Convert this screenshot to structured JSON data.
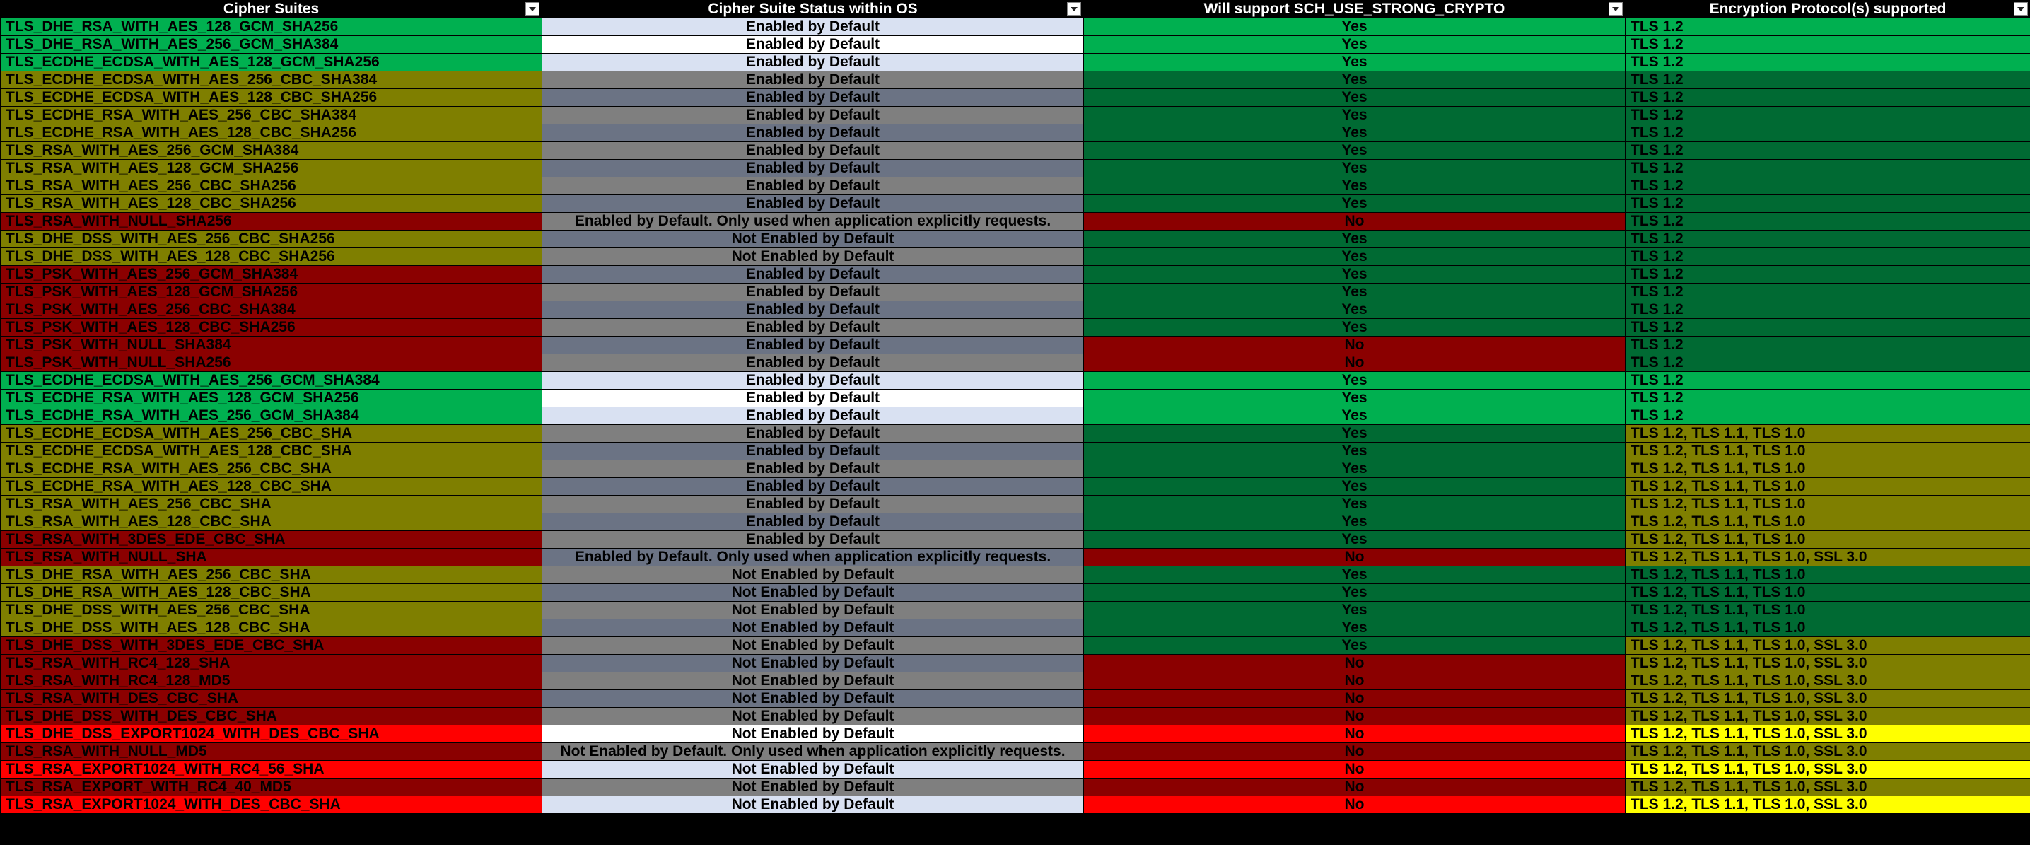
{
  "headers": [
    "Cipher Suites",
    "Cipher Suite Status within OS",
    "Will support SCH_USE_STRONG_CRYPTO",
    "Encryption Protocol(s) supported"
  ],
  "colors": {
    "bright_green": "#00b050",
    "dark_green": "#006a33",
    "olive": "#7f7f00",
    "dark_red": "#8b0000",
    "red": "#ff0000",
    "yellow": "#ffff00",
    "light_blue": "#d9e1f2",
    "white": "#ffffff",
    "gray": "#7f7f7f",
    "slate": "#6b7384"
  },
  "rows": [
    {
      "suite": "TLS_DHE_RSA_WITH_AES_128_GCM_SHA256",
      "status": "Enabled by Default",
      "strong": "Yes",
      "protocols": "TLS 1.2",
      "c1": "bright_green",
      "c2": "light_blue",
      "c3": "bright_green",
      "c4": "bright_green"
    },
    {
      "suite": "TLS_DHE_RSA_WITH_AES_256_GCM_SHA384",
      "status": "Enabled by Default",
      "strong": "Yes",
      "protocols": "TLS 1.2",
      "c1": "bright_green",
      "c2": "white",
      "c3": "bright_green",
      "c4": "bright_green"
    },
    {
      "suite": "TLS_ECDHE_ECDSA_WITH_AES_128_GCM_SHA256",
      "status": "Enabled by Default",
      "strong": "Yes",
      "protocols": "TLS 1.2",
      "c1": "bright_green",
      "c2": "light_blue",
      "c3": "bright_green",
      "c4": "bright_green"
    },
    {
      "suite": "TLS_ECDHE_ECDSA_WITH_AES_256_CBC_SHA384",
      "status": "Enabled by Default",
      "strong": "Yes",
      "protocols": "TLS 1.2",
      "c1": "olive",
      "c2": "gray",
      "c3": "dark_green",
      "c4": "dark_green"
    },
    {
      "suite": "TLS_ECDHE_ECDSA_WITH_AES_128_CBC_SHA256",
      "status": "Enabled by Default",
      "strong": "Yes",
      "protocols": "TLS 1.2",
      "c1": "olive",
      "c2": "slate",
      "c3": "dark_green",
      "c4": "dark_green"
    },
    {
      "suite": "TLS_ECDHE_RSA_WITH_AES_256_CBC_SHA384",
      "status": "Enabled by Default",
      "strong": "Yes",
      "protocols": "TLS 1.2",
      "c1": "olive",
      "c2": "gray",
      "c3": "dark_green",
      "c4": "dark_green"
    },
    {
      "suite": "TLS_ECDHE_RSA_WITH_AES_128_CBC_SHA256",
      "status": "Enabled by Default",
      "strong": "Yes",
      "protocols": "TLS 1.2",
      "c1": "olive",
      "c2": "slate",
      "c3": "dark_green",
      "c4": "dark_green"
    },
    {
      "suite": "TLS_RSA_WITH_AES_256_GCM_SHA384",
      "status": "Enabled by Default",
      "strong": "Yes",
      "protocols": "TLS 1.2",
      "c1": "olive",
      "c2": "gray",
      "c3": "dark_green",
      "c4": "dark_green"
    },
    {
      "suite": "TLS_RSA_WITH_AES_128_GCM_SHA256",
      "status": "Enabled by Default",
      "strong": "Yes",
      "protocols": "TLS 1.2",
      "c1": "olive",
      "c2": "slate",
      "c3": "dark_green",
      "c4": "dark_green"
    },
    {
      "suite": "TLS_RSA_WITH_AES_256_CBC_SHA256",
      "status": "Enabled by Default",
      "strong": "Yes",
      "protocols": "TLS 1.2",
      "c1": "olive",
      "c2": "gray",
      "c3": "dark_green",
      "c4": "dark_green"
    },
    {
      "suite": "TLS_RSA_WITH_AES_128_CBC_SHA256",
      "status": "Enabled by Default",
      "strong": "Yes",
      "protocols": "TLS 1.2",
      "c1": "olive",
      "c2": "slate",
      "c3": "dark_green",
      "c4": "dark_green"
    },
    {
      "suite": "TLS_RSA_WITH_NULL_SHA256",
      "status": "Enabled by Default. Only used when application explicitly requests.",
      "strong": "No",
      "protocols": "TLS 1.2",
      "c1": "dark_red",
      "c2": "gray",
      "c3": "dark_red",
      "c4": "dark_green"
    },
    {
      "suite": "TLS_DHE_DSS_WITH_AES_256_CBC_SHA256",
      "status": "Not Enabled by Default",
      "strong": "Yes",
      "protocols": "TLS 1.2",
      "c1": "olive",
      "c2": "slate",
      "c3": "dark_green",
      "c4": "dark_green"
    },
    {
      "suite": "TLS_DHE_DSS_WITH_AES_128_CBC_SHA256",
      "status": "Not Enabled by Default",
      "strong": "Yes",
      "protocols": "TLS 1.2",
      "c1": "olive",
      "c2": "gray",
      "c3": "dark_green",
      "c4": "dark_green"
    },
    {
      "suite": "TLS_PSK_WITH_AES_256_GCM_SHA384",
      "status": "Enabled by Default",
      "strong": "Yes",
      "protocols": "TLS 1.2",
      "c1": "dark_red",
      "c2": "slate",
      "c3": "dark_green",
      "c4": "dark_green"
    },
    {
      "suite": "TLS_PSK_WITH_AES_128_GCM_SHA256",
      "status": "Enabled by Default",
      "strong": "Yes",
      "protocols": "TLS 1.2",
      "c1": "dark_red",
      "c2": "gray",
      "c3": "dark_green",
      "c4": "dark_green"
    },
    {
      "suite": "TLS_PSK_WITH_AES_256_CBC_SHA384",
      "status": "Enabled by Default",
      "strong": "Yes",
      "protocols": "TLS 1.2",
      "c1": "dark_red",
      "c2": "slate",
      "c3": "dark_green",
      "c4": "dark_green"
    },
    {
      "suite": "TLS_PSK_WITH_AES_128_CBC_SHA256",
      "status": "Enabled by Default",
      "strong": "Yes",
      "protocols": "TLS 1.2",
      "c1": "dark_red",
      "c2": "gray",
      "c3": "dark_green",
      "c4": "dark_green"
    },
    {
      "suite": "TLS_PSK_WITH_NULL_SHA384",
      "status": "Enabled by Default",
      "strong": "No",
      "protocols": "TLS 1.2",
      "c1": "dark_red",
      "c2": "slate",
      "c3": "dark_red",
      "c4": "dark_green"
    },
    {
      "suite": "TLS_PSK_WITH_NULL_SHA256",
      "status": "Enabled by Default",
      "strong": "No",
      "protocols": "TLS 1.2",
      "c1": "dark_red",
      "c2": "gray",
      "c3": "dark_red",
      "c4": "dark_green"
    },
    {
      "suite": "TLS_ECDHE_ECDSA_WITH_AES_256_GCM_SHA384",
      "status": "Enabled by Default",
      "strong": "Yes",
      "protocols": "TLS 1.2",
      "c1": "bright_green",
      "c2": "light_blue",
      "c3": "bright_green",
      "c4": "bright_green"
    },
    {
      "suite": "TLS_ECDHE_RSA_WITH_AES_128_GCM_SHA256",
      "status": "Enabled by Default",
      "strong": "Yes",
      "protocols": "TLS 1.2",
      "c1": "bright_green",
      "c2": "white",
      "c3": "bright_green",
      "c4": "bright_green"
    },
    {
      "suite": "TLS_ECDHE_RSA_WITH_AES_256_GCM_SHA384",
      "status": "Enabled by Default",
      "strong": "Yes",
      "protocols": "TLS 1.2",
      "c1": "bright_green",
      "c2": "light_blue",
      "c3": "bright_green",
      "c4": "bright_green"
    },
    {
      "suite": "TLS_ECDHE_ECDSA_WITH_AES_256_CBC_SHA",
      "status": "Enabled by Default",
      "strong": "Yes",
      "protocols": "TLS 1.2, TLS 1.1, TLS 1.0",
      "c1": "olive",
      "c2": "gray",
      "c3": "dark_green",
      "c4": "olive"
    },
    {
      "suite": "TLS_ECDHE_ECDSA_WITH_AES_128_CBC_SHA",
      "status": "Enabled by Default",
      "strong": "Yes",
      "protocols": "TLS 1.2, TLS 1.1, TLS 1.0",
      "c1": "olive",
      "c2": "slate",
      "c3": "dark_green",
      "c4": "olive"
    },
    {
      "suite": "TLS_ECDHE_RSA_WITH_AES_256_CBC_SHA",
      "status": "Enabled by Default",
      "strong": "Yes",
      "protocols": "TLS 1.2, TLS 1.1, TLS 1.0",
      "c1": "olive",
      "c2": "gray",
      "c3": "dark_green",
      "c4": "olive"
    },
    {
      "suite": "TLS_ECDHE_RSA_WITH_AES_128_CBC_SHA",
      "status": "Enabled by Default",
      "strong": "Yes",
      "protocols": "TLS 1.2, TLS 1.1, TLS 1.0",
      "c1": "olive",
      "c2": "slate",
      "c3": "dark_green",
      "c4": "olive"
    },
    {
      "suite": "TLS_RSA_WITH_AES_256_CBC_SHA",
      "status": "Enabled by Default",
      "strong": "Yes",
      "protocols": "TLS 1.2, TLS 1.1, TLS 1.0",
      "c1": "olive",
      "c2": "gray",
      "c3": "dark_green",
      "c4": "olive"
    },
    {
      "suite": "TLS_RSA_WITH_AES_128_CBC_SHA",
      "status": "Enabled by Default",
      "strong": "Yes",
      "protocols": "TLS 1.2, TLS 1.1, TLS 1.0",
      "c1": "olive",
      "c2": "slate",
      "c3": "dark_green",
      "c4": "olive"
    },
    {
      "suite": "TLS_RSA_WITH_3DES_EDE_CBC_SHA",
      "status": "Enabled by Default",
      "strong": "Yes",
      "protocols": "TLS 1.2, TLS 1.1, TLS 1.0",
      "c1": "dark_red",
      "c2": "gray",
      "c3": "dark_green",
      "c4": "olive"
    },
    {
      "suite": "TLS_RSA_WITH_NULL_SHA",
      "status": "Enabled by Default. Only used when application explicitly requests.",
      "strong": "No",
      "protocols": "TLS 1.2, TLS 1.1, TLS 1.0, SSL 3.0",
      "c1": "dark_red",
      "c2": "slate",
      "c3": "dark_red",
      "c4": "olive"
    },
    {
      "suite": "TLS_DHE_RSA_WITH_AES_256_CBC_SHA",
      "status": "Not Enabled by Default",
      "strong": "Yes",
      "protocols": "TLS 1.2, TLS 1.1, TLS 1.0",
      "c1": "olive",
      "c2": "gray",
      "c3": "dark_green",
      "c4": "dark_green"
    },
    {
      "suite": "TLS_DHE_RSA_WITH_AES_128_CBC_SHA",
      "status": "Not Enabled by Default",
      "strong": "Yes",
      "protocols": "TLS 1.2, TLS 1.1, TLS 1.0",
      "c1": "olive",
      "c2": "slate",
      "c3": "dark_green",
      "c4": "dark_green"
    },
    {
      "suite": "TLS_DHE_DSS_WITH_AES_256_CBC_SHA",
      "status": "Not Enabled by Default",
      "strong": "Yes",
      "protocols": "TLS 1.2, TLS 1.1, TLS 1.0",
      "c1": "olive",
      "c2": "gray",
      "c3": "dark_green",
      "c4": "dark_green"
    },
    {
      "suite": "TLS_DHE_DSS_WITH_AES_128_CBC_SHA",
      "status": "Not Enabled by Default",
      "strong": "Yes",
      "protocols": "TLS 1.2, TLS 1.1, TLS 1.0",
      "c1": "olive",
      "c2": "slate",
      "c3": "dark_green",
      "c4": "dark_green"
    },
    {
      "suite": "TLS_DHE_DSS_WITH_3DES_EDE_CBC_SHA",
      "status": "Not Enabled by Default",
      "strong": "Yes",
      "protocols": "TLS 1.2, TLS 1.1, TLS 1.0, SSL 3.0",
      "c1": "dark_red",
      "c2": "gray",
      "c3": "dark_green",
      "c4": "olive"
    },
    {
      "suite": "TLS_RSA_WITH_RC4_128_SHA",
      "status": "Not Enabled by Default",
      "strong": "No",
      "protocols": "TLS 1.2, TLS 1.1, TLS 1.0, SSL 3.0",
      "c1": "dark_red",
      "c2": "slate",
      "c3": "dark_red",
      "c4": "olive"
    },
    {
      "suite": "TLS_RSA_WITH_RC4_128_MD5",
      "status": "Not Enabled by Default",
      "strong": "No",
      "protocols": "TLS 1.2, TLS 1.1, TLS 1.0, SSL 3.0",
      "c1": "dark_red",
      "c2": "gray",
      "c3": "dark_red",
      "c4": "olive"
    },
    {
      "suite": "TLS_RSA_WITH_DES_CBC_SHA",
      "status": "Not Enabled by Default",
      "strong": "No",
      "protocols": "TLS 1.2, TLS 1.1, TLS 1.0, SSL 3.0",
      "c1": "dark_red",
      "c2": "slate",
      "c3": "dark_red",
      "c4": "olive"
    },
    {
      "suite": "TLS_DHE_DSS_WITH_DES_CBC_SHA",
      "status": "Not Enabled by Default",
      "strong": "No",
      "protocols": "TLS 1.2, TLS 1.1, TLS 1.0, SSL 3.0",
      "c1": "dark_red",
      "c2": "gray",
      "c3": "dark_red",
      "c4": "olive"
    },
    {
      "suite": "TLS_DHE_DSS_EXPORT1024_WITH_DES_CBC_SHA",
      "status": "Not Enabled by Default",
      "strong": "No",
      "protocols": "TLS 1.2, TLS 1.1, TLS 1.0, SSL 3.0",
      "c1": "red",
      "c2": "white",
      "c3": "red",
      "c4": "yellow"
    },
    {
      "suite": "TLS_RSA_WITH_NULL_MD5",
      "status": "Not Enabled by Default. Only used when application explicitly requests.",
      "strong": "No",
      "protocols": "TLS 1.2, TLS 1.1, TLS 1.0, SSL 3.0",
      "c1": "dark_red",
      "c2": "gray",
      "c3": "dark_red",
      "c4": "olive"
    },
    {
      "suite": "TLS_RSA_EXPORT1024_WITH_RC4_56_SHA",
      "status": "Not Enabled by Default",
      "strong": "No",
      "protocols": "TLS 1.2, TLS 1.1, TLS 1.0, SSL 3.0",
      "c1": "red",
      "c2": "light_blue",
      "c3": "red",
      "c4": "yellow"
    },
    {
      "suite": "TLS_RSA_EXPORT_WITH_RC4_40_MD5",
      "status": "Not Enabled by Default",
      "strong": "No",
      "protocols": "TLS 1.2, TLS 1.1, TLS 1.0, SSL 3.0",
      "c1": "dark_red",
      "c2": "gray",
      "c3": "dark_red",
      "c4": "olive"
    },
    {
      "suite": "TLS_RSA_EXPORT1024_WITH_DES_CBC_SHA",
      "status": "Not Enabled by Default",
      "strong": "No",
      "protocols": "TLS 1.2, TLS 1.1, TLS 1.0, SSL 3.0",
      "c1": "red",
      "c2": "light_blue",
      "c3": "red",
      "c4": "yellow"
    }
  ]
}
